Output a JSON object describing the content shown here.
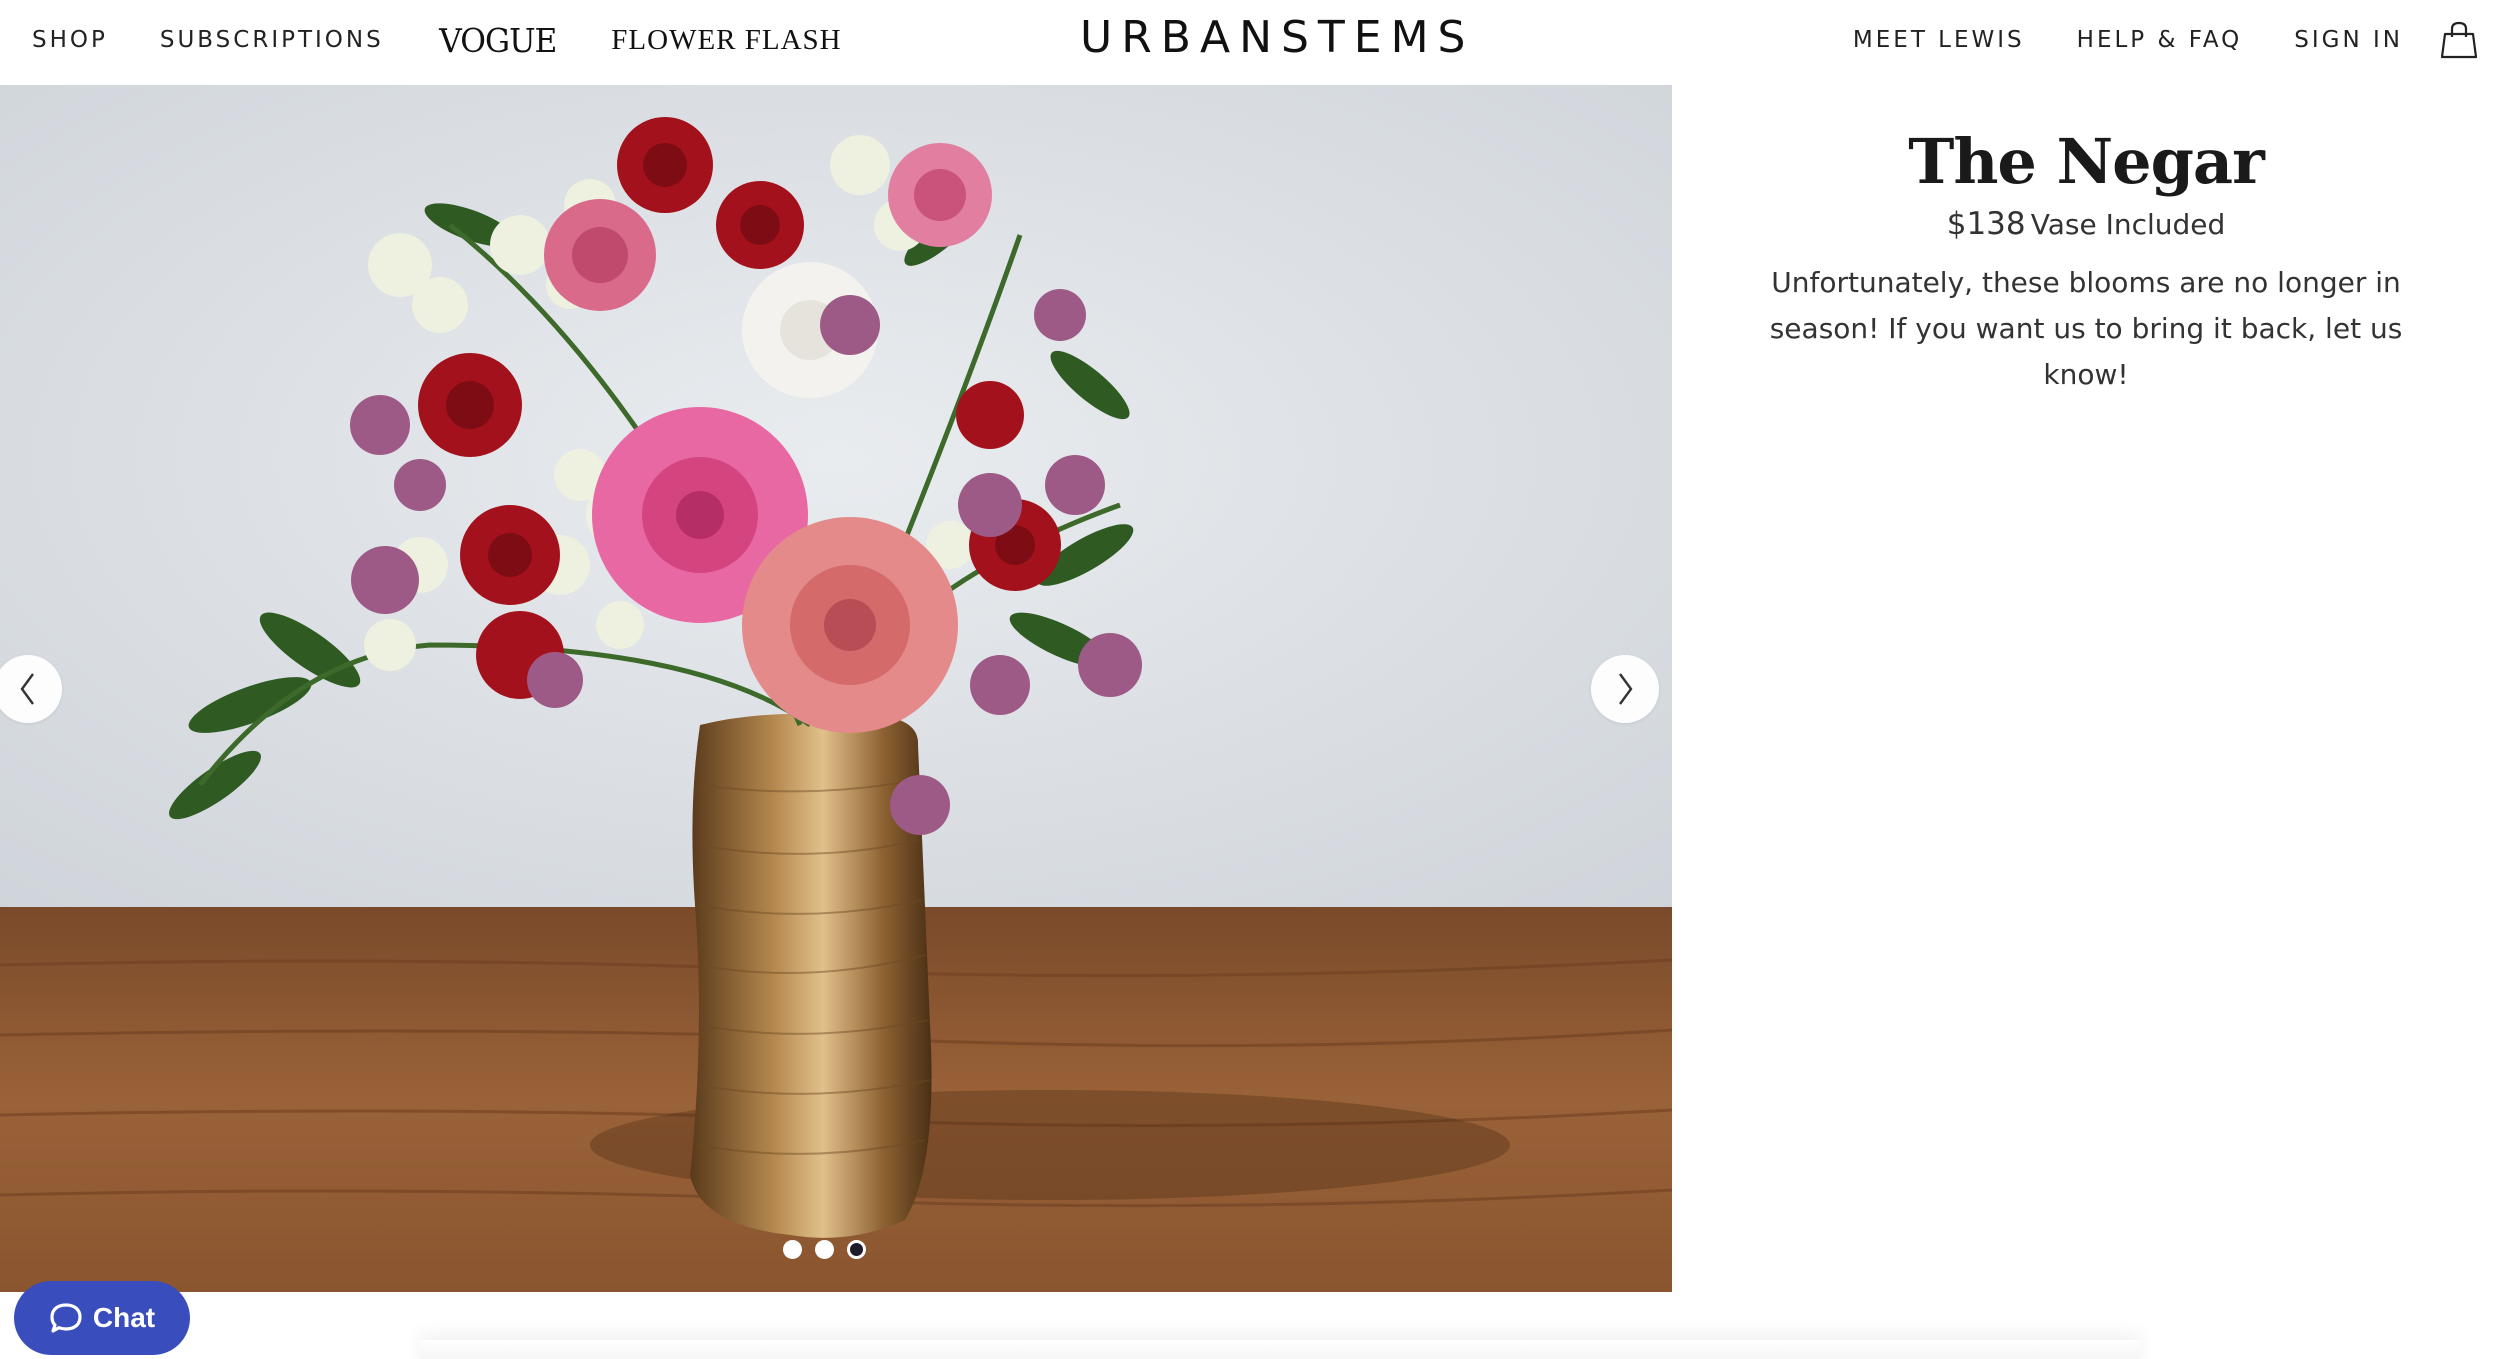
{
  "header": {
    "nav_left": [
      "SHOP",
      "SUBSCRIPTIONS"
    ],
    "vogue": "VOGUE",
    "flower_flash": "FLOWER FLASH",
    "logo": "URBANSTEMS",
    "nav_right": [
      "MEET LEWIS",
      "HELP & FAQ",
      "SIGN IN"
    ],
    "bag_icon": "shopping-bag-icon"
  },
  "product": {
    "title": "The Negar",
    "price": "$138",
    "price_note": "Vase Included",
    "description": "Unfortunately, these blooms are no longer in season! If you want us to bring it back, let us know!"
  },
  "carousel": {
    "slides": 3,
    "active_slide": 3,
    "prev_icon": "chevron-left-icon",
    "next_icon": "chevron-right-icon"
  },
  "chat": {
    "label": "Chat",
    "icon": "chat-bubble-icon",
    "color": "#3a4dbd"
  }
}
